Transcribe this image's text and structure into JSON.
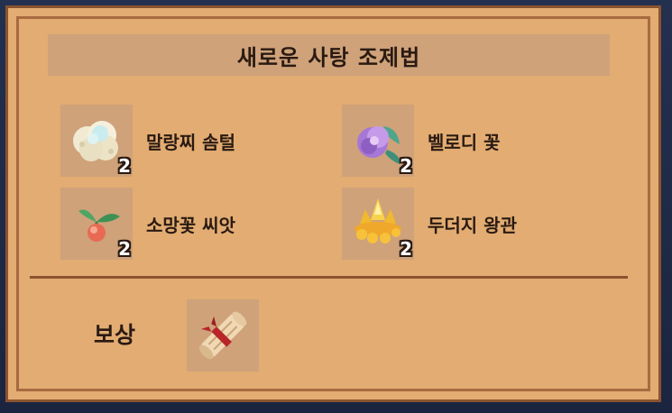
{
  "dialog": {
    "title": "새로운 사탕 조제법"
  },
  "ingredients": [
    {
      "name": "말랑찌 솜털",
      "count": "2",
      "icon": "cotton-fluff-icon"
    },
    {
      "name": "벨로디 꽃",
      "count": "2",
      "icon": "purple-flower-icon"
    },
    {
      "name": "소망꽃 씨앗",
      "count": "2",
      "icon": "seed-sprout-icon"
    },
    {
      "name": "두더지 왕관",
      "count": "2",
      "icon": "gold-crown-icon"
    }
  ],
  "reward": {
    "label": "보상",
    "icon": "recipe-scroll-icon"
  }
}
